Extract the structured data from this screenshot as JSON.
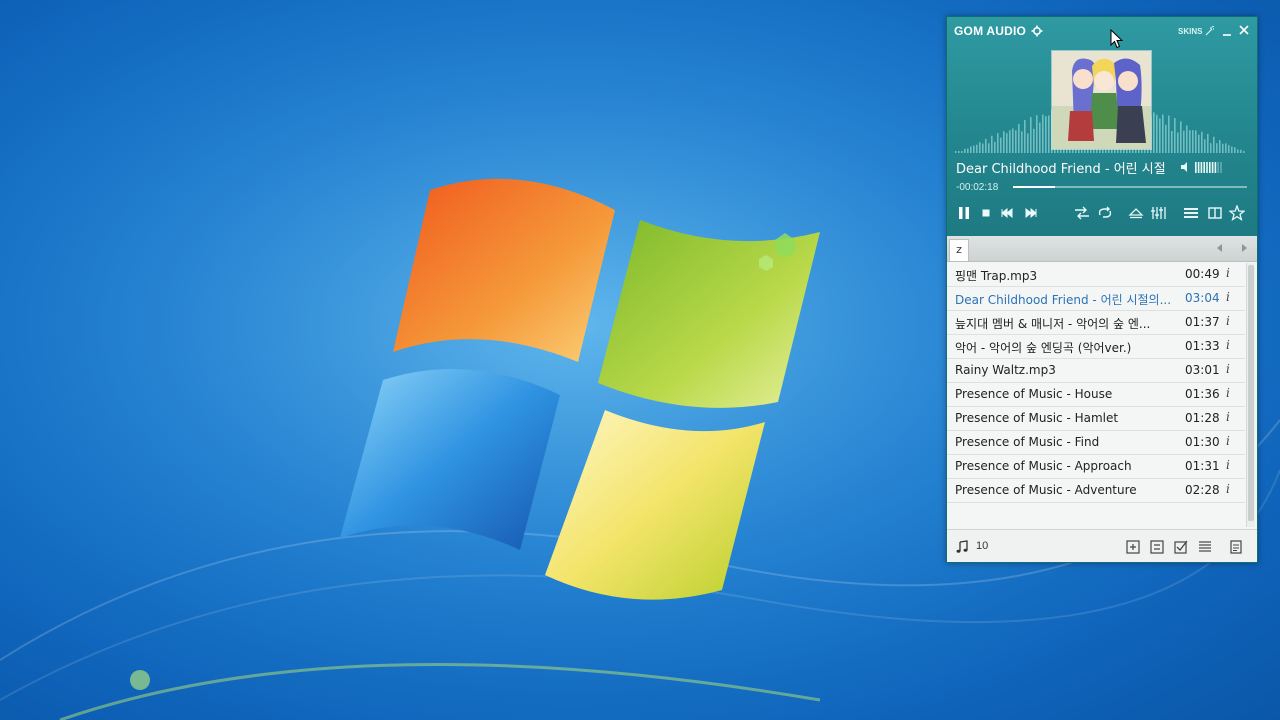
{
  "player": {
    "app_title": "GOM AUDIO",
    "skins_label": "SKINS",
    "now_playing": "Dear Childhood Friend - 어린 시절",
    "elapsed": "-00:02:18",
    "progress": 0.18,
    "volume_level": 0.8,
    "accent_color": "#23868e"
  },
  "playlist": {
    "tab": "z",
    "items": [
      {
        "name": "핑맨 Trap.mp3",
        "duration": "00:49",
        "info": "i",
        "active": false
      },
      {
        "name": "Dear Childhood Friend - 어린 시절의...",
        "duration": "03:04",
        "info": "i",
        "active": true
      },
      {
        "name": "늪지대 멤버 & 매니저 - 악어의 숲 엔...",
        "duration": "01:37",
        "info": "i",
        "active": false
      },
      {
        "name": "악어 - 악어의 숲 엔딩곡 (악어ver.)",
        "duration": "01:33",
        "info": "i",
        "active": false
      },
      {
        "name": "Rainy Waltz.mp3",
        "duration": "03:01",
        "info": "i",
        "active": false
      },
      {
        "name": "Presence of Music - House",
        "duration": "01:36",
        "info": "i",
        "active": false
      },
      {
        "name": "Presence of Music - Hamlet",
        "duration": "01:28",
        "info": "i",
        "active": false
      },
      {
        "name": "Presence of Music - Find",
        "duration": "01:30",
        "info": "i",
        "active": false
      },
      {
        "name": "Presence of Music - Approach",
        "duration": "01:31",
        "info": "i",
        "active": false
      },
      {
        "name": "Presence of Music - Adventure",
        "duration": "02:28",
        "info": "i",
        "active": false
      }
    ],
    "count": "10"
  },
  "active_color": "#2c73b6"
}
